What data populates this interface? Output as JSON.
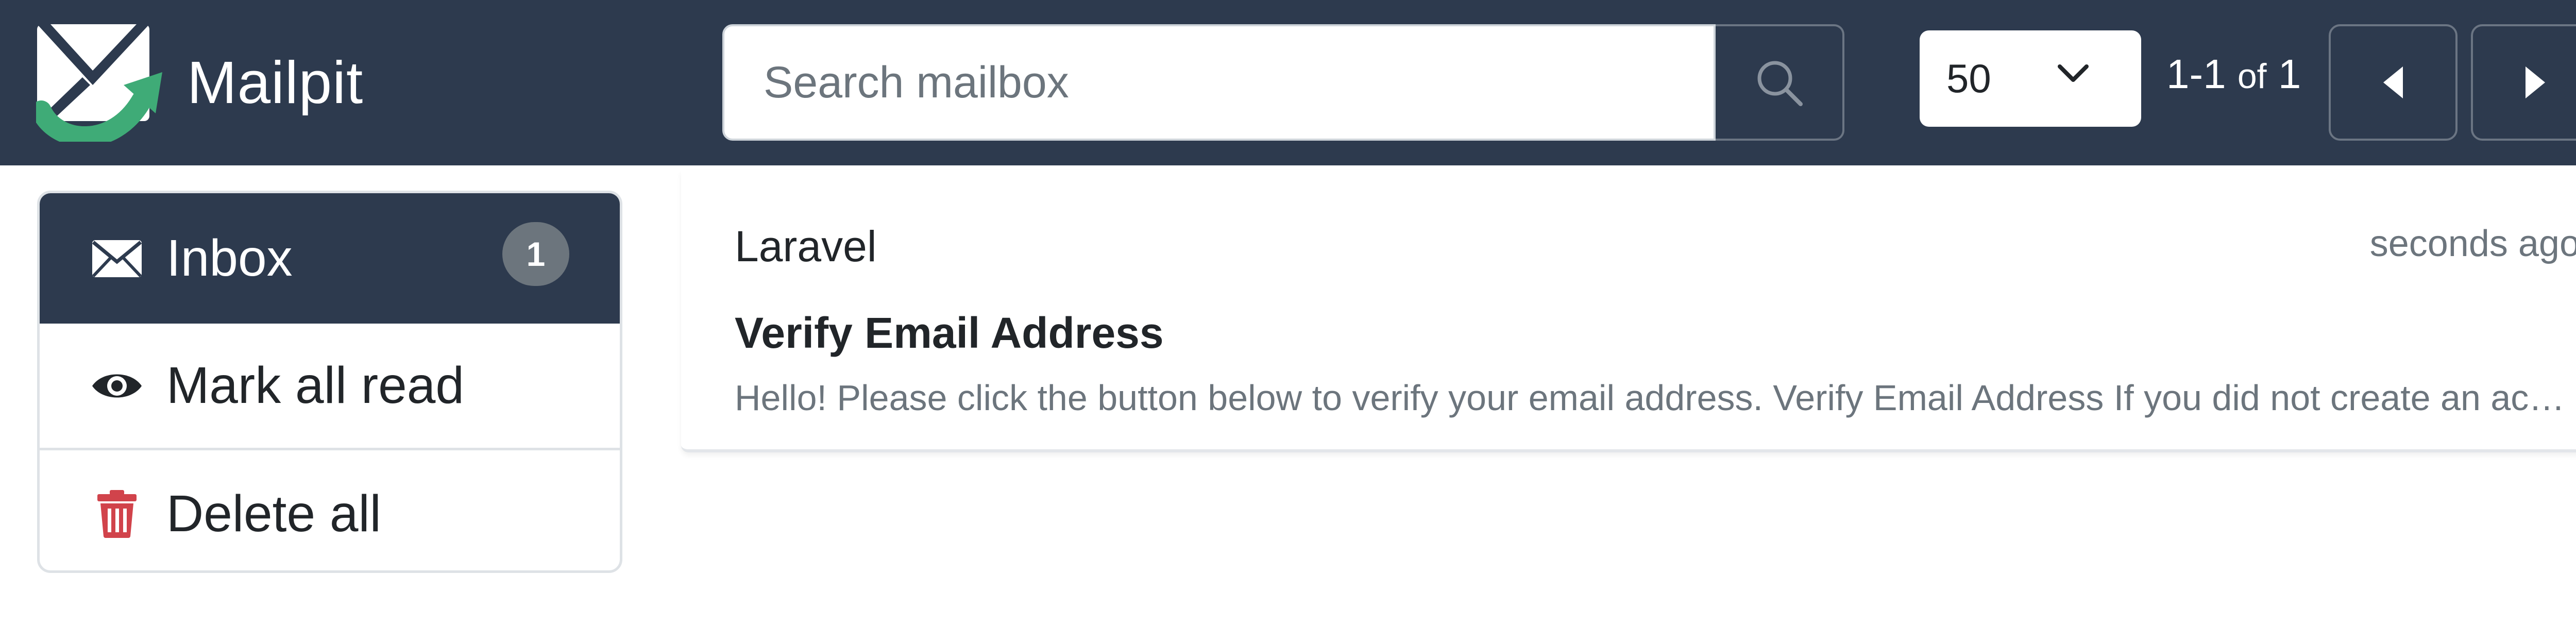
{
  "app": {
    "title": "Mailpit",
    "logo_icon": "mailpit-envelope-logo"
  },
  "search": {
    "placeholder": "Search mailbox",
    "value": "",
    "button_icon": "search-icon"
  },
  "pagination": {
    "per_page": "50",
    "range": "1-1",
    "of_label": "of",
    "total": "1",
    "prev_icon": "caret-left-icon",
    "next_icon": "caret-right-icon"
  },
  "sidebar": {
    "items": [
      {
        "label": "Inbox",
        "icon": "envelope-icon",
        "badge": "1",
        "active": true
      },
      {
        "label": "Mark all read",
        "icon": "eye-icon"
      },
      {
        "label": "Delete all",
        "icon": "trash-icon"
      }
    ]
  },
  "messages": [
    {
      "from": "Laravel",
      "time": "seconds ago",
      "subject": "Verify Email Address",
      "snippet": "Hello! Please click the button below to verify your email address. Verify Email Address If you did not create an account, no further action is required."
    }
  ],
  "colors": {
    "header_bg": "#2d3a4e",
    "logo_green": "#3fab77",
    "badge_bg": "#6c757d",
    "trash_red": "#d1434b"
  }
}
